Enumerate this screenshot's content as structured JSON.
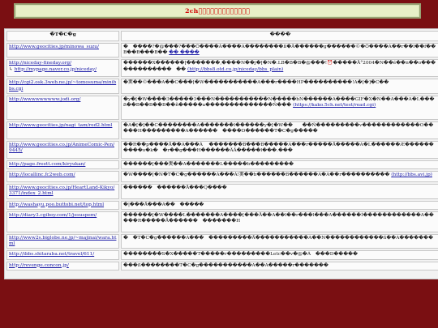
{
  "header": {
    "title": "2ch\u0000\u0000\u0000\u0000\u0000\u0000\u0000\u0000\u0000\u0000\u0000\u0000\u0000"
  },
  "table": {
    "col_url": "�T�C�g",
    "col_desc": "����",
    "rows": [
      {
        "url": "http://www.geocities.jp/minowa_suzu/",
        "desc": "�　����?�@���?���Ô����À����A��������ß�Ä������g������©�Ö����A��r��l��f��B��B���B��",
        "desc_link": "�� ����"
      },
      {
        "url": "http://niceday-fineday.org/",
        "url2": "http://mypage.naver.co.jp/niceday/",
        "desc": "������X������[�������‚����N��j�[�N�.LB�B�B�@���!⏰�����Å°2004�N��é��n��o�������������　��",
        "desc_link": "(http://bbs8.otd.co.jp/niceday/bbs_plain)"
      },
      {
        "url": "http://cgi2.osk.3web.ne.jp/~tomosuma/minibbs.cgi",
        "desc": "�実��©���A��C���[�W�����������A���r����HP����������!A�[�]�C��"
      },
      {
        "url": "http://wwwwwwwww.jodi.org/",
        "desc": "�y�[�W����3�����3���N�����������N�����bN������A����GIF�X�N��A���A�L���ß��B��B��B��ñ�����a��������������Ñ���",
        "desc_link": "(https://kako.5ch.net/test/read.cgi)"
      },
      {
        "url": "http://www.geocities.jp/nagi_tam/red2.html",
        "desc": "�A�[�]��C��������A�������l������y�[�W��　 ��Ñ���������v������������O�����H���������A������　����D������T�C�g�����"
      },
      {
        "url": "http://www.geocities.co.jp/AnimeComic-Pen/9445/",
        "desc": "��R��p����Å��A���Á 　�������B���B�����A���r�����Å�����A�L������Æ����������o�k�　�r��g���H������ÄÂ�����l���.���"
      },
      {
        "url": "http://page.freett.com/kiryukan/",
        "desc": "������[���実��A�������L�����b���������"
      },
      {
        "url": "http://locallinc.fc2web.com/",
        "desc": "�W����[�N�T�C�g������A���Á!実��b������B������A�A��r����������",
        "desc_link": "(http://bbs.avi.jp)"
      },
      {
        "url": "http://www.geocities.co.jp/HeartLand-Kikyo/3371/index_2.html",
        "desc": "������　������Å���Q����"
      },
      {
        "url": "http://washayu.poo.buttobi.net/top.html",
        "desc": "�|���Å���A��　�����"
      },
      {
        "url": "http://diary3.cgiboy.com/1/jesuspem/",
        "desc": "������[�W����L�������A����[���Å��A��l��r���l���A������Í������������A�����R�����Å������　�������H"
      },
      {
        "url": "http://www2s.biglobe.ne.jp/~majinai/wara.html",
        "desc": "�　�T�C�g������A���　���������Å�����������A��N������������ñ��A�������"
      },
      {
        "url": "http://ibbs.shitaraba.net/travel/611/",
        "desc": "��������S�X�����T�����r���������Letc��v�@�Á　���D�����"
      },
      {
        "url": "http://revenge.concon.jp/",
        "desc": "���ß��������T�C�g�����������A��A�����r�������"
      }
    ]
  },
  "colors": {
    "background": "#7a0f12",
    "header_bg": "#e7f0c7",
    "header_text": "#d10000",
    "link": "#1a1aa6"
  }
}
